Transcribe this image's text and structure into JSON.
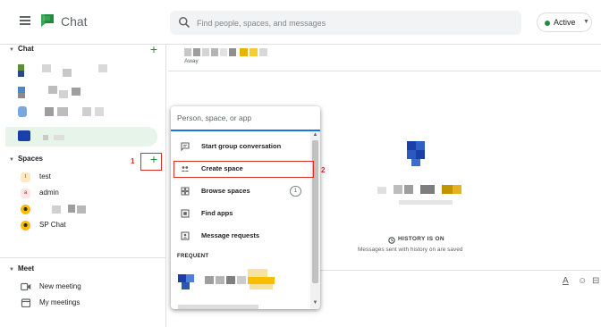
{
  "app": {
    "title": "Chat",
    "search_placeholder": "Find people, spaces, and messages",
    "status_label": "Active",
    "brand_color": "#1e8e3e"
  },
  "sidebar": {
    "chat_section_label": "Chat",
    "spaces_section_label": "Spaces",
    "spaces": [
      {
        "name": "test",
        "icon_letter": "t"
      },
      {
        "name": "admin",
        "icon_letter": "a"
      },
      {
        "name": "",
        "icon_letter": ""
      },
      {
        "name": "SP Chat",
        "icon_letter": ""
      }
    ],
    "meet_section_label": "Meet",
    "meet_items": [
      {
        "label": "New meeting",
        "icon": "video-camera-icon"
      },
      {
        "label": "My meetings",
        "icon": "calendar-icon"
      }
    ]
  },
  "annotations": {
    "step1": "1",
    "step2": "2"
  },
  "conversation": {
    "away_status": "Away",
    "history_label": "HISTORY IS ON",
    "history_sub": "Messages sent with history on are saved"
  },
  "popup": {
    "search_placeholder": "Person, space, or app",
    "items": [
      {
        "label": "Start group conversation",
        "icon": "group-chat-icon"
      },
      {
        "label": "Create space",
        "icon": "create-space-icon"
      },
      {
        "label": "Browse spaces",
        "icon": "browse-spaces-icon",
        "badge": "1"
      },
      {
        "label": "Find apps",
        "icon": "apps-icon"
      },
      {
        "label": "Message requests",
        "icon": "message-requests-icon"
      }
    ],
    "frequent_label": "FREQUENT"
  }
}
